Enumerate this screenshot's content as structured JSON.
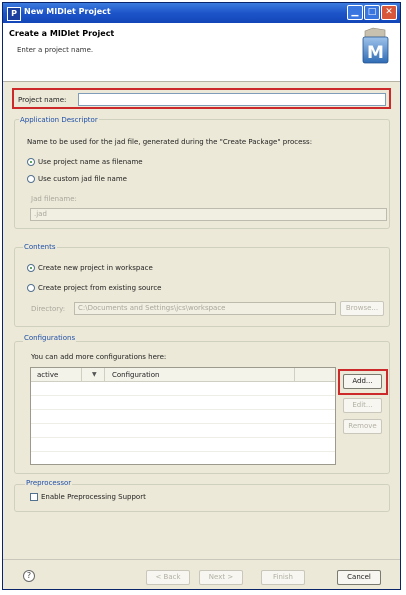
{
  "window": {
    "title": "New MIDlet Project",
    "app_icon_letter": "P"
  },
  "header": {
    "title": "Create a MIDlet Project",
    "subtitle": "Enter a project name.",
    "logo_letter": "M"
  },
  "project_name": {
    "label": "Project name:",
    "value": ""
  },
  "application_descriptor": {
    "group_label": "Application Descriptor",
    "description": "Name to be used for the jad file, generated during the \"Create Package\" process:",
    "option_use_project_name": "Use project name as filename",
    "option_use_custom": "Use custom jad file name",
    "jad_filename_label": "Jad filename:",
    "jad_filename_value": ".jad",
    "selected": "use_project_name"
  },
  "contents": {
    "group_label": "Contents",
    "option_new": "Create new project in workspace",
    "option_existing": "Create project from existing source",
    "directory_label": "Directory:",
    "directory_value": "C:\\Documents and Settings\\jcs\\workspace",
    "browse_label": "Browse...",
    "selected": "new"
  },
  "configurations": {
    "group_label": "Configurations",
    "description": "You can add more configurations here:",
    "columns": [
      "active",
      "▼",
      "Configuration"
    ],
    "rows": [],
    "add_label": "Add...",
    "edit_label": "Edit...",
    "remove_label": "Remove"
  },
  "preprocessor": {
    "group_label": "Preprocessor",
    "checkbox_label": "Enable Preprocessing Support",
    "checked": false
  },
  "footer": {
    "help_symbol": "?",
    "back_label": "< Back",
    "next_label": "Next >",
    "finish_label": "Finish",
    "cancel_label": "Cancel"
  }
}
